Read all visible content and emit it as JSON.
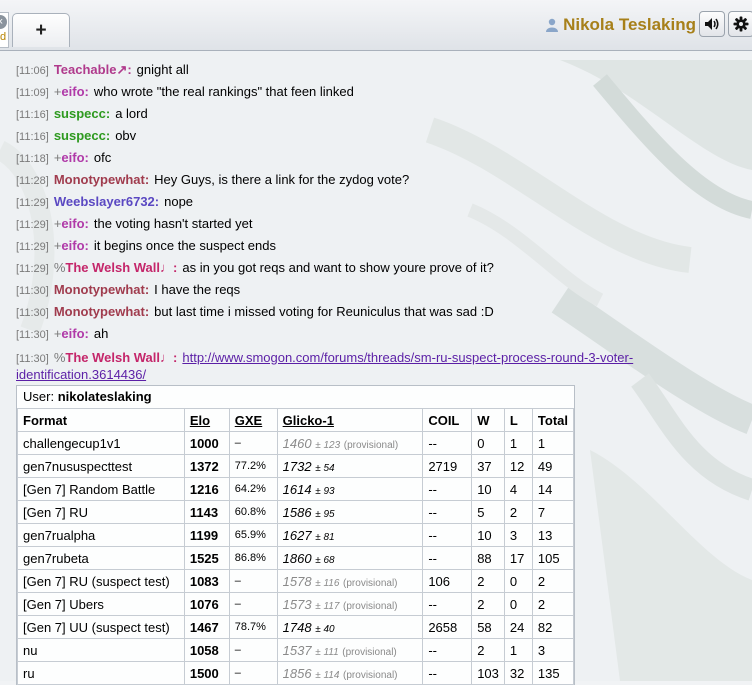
{
  "header": {
    "new_tab_label": "+",
    "closed_tab_fragment": "d",
    "username": "Nikola Teslaking",
    "sound_icon": "speaker-icon",
    "settings_icon": "gear-icon"
  },
  "colors": {
    "username": "#a7801a",
    "timestamp": "#7a7a7a",
    "link": "#5b1fa6"
  },
  "chat": [
    {
      "time": "[11:06]",
      "group": "",
      "user": "Teachable↗:",
      "user_color": "#b03a8c",
      "text": "gnight all"
    },
    {
      "time": "[11:09]",
      "group": "+",
      "user": "eifo:",
      "user_color": "#b03aa8",
      "text": "who wrote \"the real rankings\" that feen linked"
    },
    {
      "time": "[11:16]",
      "group": "",
      "user": "suspecc:",
      "user_color": "#2e9a1f",
      "text": "a lord"
    },
    {
      "time": "[11:16]",
      "group": "",
      "user": "suspecc:",
      "user_color": "#2e9a1f",
      "text": "obv"
    },
    {
      "time": "[11:18]",
      "group": "+",
      "user": "eifo:",
      "user_color": "#b03aa8",
      "text": "ofc"
    },
    {
      "time": "[11:28]",
      "group": "",
      "user": "Monotypewhat:",
      "user_color": "#a03c4e",
      "text": "Hey Guys, is there a link for the zydog vote?"
    },
    {
      "time": "[11:29]",
      "group": "",
      "user": "Weebslayer6732:",
      "user_color": "#5a48c2",
      "text": "nope"
    },
    {
      "time": "[11:29]",
      "group": "+",
      "user": "eifo:",
      "user_color": "#b03aa8",
      "text": "the voting hasn't started yet"
    },
    {
      "time": "[11:29]",
      "group": "+",
      "user": "eifo:",
      "user_color": "#b03aa8",
      "text": "it begins once the suspect ends"
    },
    {
      "time": "[11:29]",
      "group": "%",
      "user": "The Welsh Wall♩:",
      "user_color": "#c4266a",
      "text": "as in you got reqs and want to show youre prove of it?"
    },
    {
      "time": "[11:30]",
      "group": "",
      "user": "Monotypewhat:",
      "user_color": "#a03c4e",
      "text": "I have the reqs"
    },
    {
      "time": "[11:30]",
      "group": "",
      "user": "Monotypewhat:",
      "user_color": "#a03c4e",
      "text": "but last time i missed voting for Reuniculus that was sad :D"
    },
    {
      "time": "[11:30]",
      "group": "+",
      "user": "eifo:",
      "user_color": "#b03aa8",
      "text": "ah"
    }
  ],
  "link_message": {
    "time": "[11:30]",
    "group": "%",
    "user": "The Welsh Wall♩:",
    "user_color": "#c4266a",
    "link": "http://www.smogon.com/forums/threads/sm-ru-suspect-process-round-3-voter-identification.3614436/"
  },
  "ranking": {
    "user_label": "User:",
    "user": "nikolateslaking",
    "columns": [
      "Format",
      "Elo",
      "GXE",
      "Glicko-1",
      "COIL",
      "W",
      "L",
      "Total"
    ],
    "rows": [
      {
        "format": "challengecup1v1",
        "elo": "1000",
        "gxe": "–",
        "glicko": "1460",
        "dev": "± 123",
        "prov": "(provisional)",
        "coil": "--",
        "w": "0",
        "l": "1",
        "total": "1"
      },
      {
        "format": "gen7nususpecttest",
        "elo": "1372",
        "gxe": "77.2%",
        "glicko": "1732",
        "dev": "± 54",
        "prov": "",
        "coil": "2719",
        "w": "37",
        "l": "12",
        "total": "49"
      },
      {
        "format": "[Gen 7] Random Battle",
        "elo": "1216",
        "gxe": "64.2%",
        "glicko": "1614",
        "dev": "± 93",
        "prov": "",
        "coil": "--",
        "w": "10",
        "l": "4",
        "total": "14"
      },
      {
        "format": "[Gen 7] RU",
        "elo": "1143",
        "gxe": "60.8%",
        "glicko": "1586",
        "dev": "± 95",
        "prov": "",
        "coil": "--",
        "w": "5",
        "l": "2",
        "total": "7"
      },
      {
        "format": "gen7rualpha",
        "elo": "1199",
        "gxe": "65.9%",
        "glicko": "1627",
        "dev": "± 81",
        "prov": "",
        "coil": "--",
        "w": "10",
        "l": "3",
        "total": "13"
      },
      {
        "format": "gen7rubeta",
        "elo": "1525",
        "gxe": "86.8%",
        "glicko": "1860",
        "dev": "± 68",
        "prov": "",
        "coil": "--",
        "w": "88",
        "l": "17",
        "total": "105"
      },
      {
        "format": "[Gen 7] RU (suspect test)",
        "elo": "1083",
        "gxe": "–",
        "glicko": "1578",
        "dev": "± 116",
        "prov": "(provisional)",
        "coil": "106",
        "w": "2",
        "l": "0",
        "total": "2"
      },
      {
        "format": "[Gen 7] Ubers",
        "elo": "1076",
        "gxe": "–",
        "glicko": "1573",
        "dev": "± 117",
        "prov": "(provisional)",
        "coil": "--",
        "w": "2",
        "l": "0",
        "total": "2"
      },
      {
        "format": "[Gen 7] UU (suspect test)",
        "elo": "1467",
        "gxe": "78.7%",
        "glicko": "1748",
        "dev": "± 40",
        "prov": "",
        "coil": "2658",
        "w": "58",
        "l": "24",
        "total": "82"
      },
      {
        "format": "nu",
        "elo": "1058",
        "gxe": "–",
        "glicko": "1537",
        "dev": "± 111",
        "prov": "(provisional)",
        "coil": "--",
        "w": "2",
        "l": "1",
        "total": "3"
      },
      {
        "format": "ru",
        "elo": "1500",
        "gxe": "–",
        "glicko": "1856",
        "dev": "± 114",
        "prov": "(provisional)",
        "coil": "--",
        "w": "103",
        "l": "32",
        "total": "135"
      }
    ]
  }
}
